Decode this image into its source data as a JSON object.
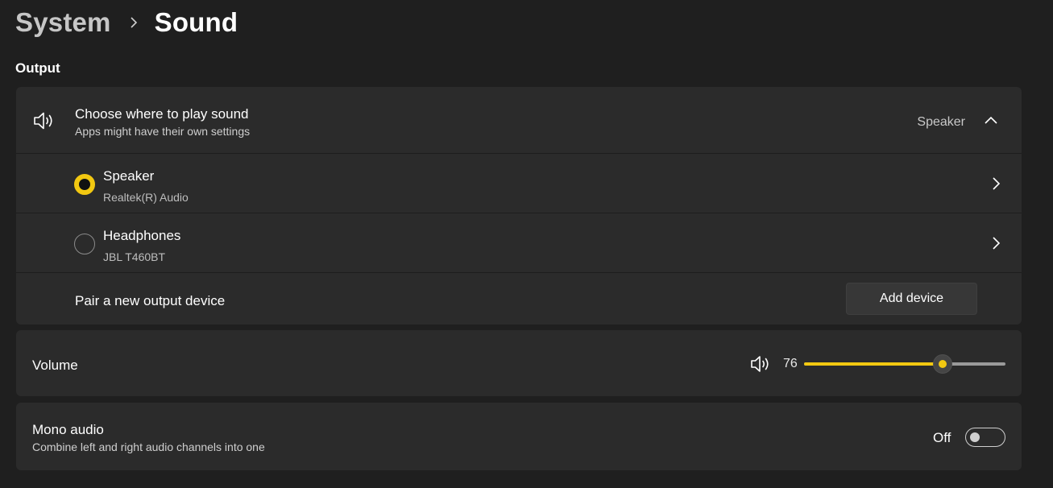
{
  "breadcrumb": {
    "parent": "System",
    "current": "Sound"
  },
  "section": {
    "output_label": "Output"
  },
  "output": {
    "title": "Choose where to play sound",
    "subtitle": "Apps might have their own settings",
    "selected_value": "Speaker",
    "devices": [
      {
        "name": "Speaker",
        "detail": "Realtek(R) Audio",
        "selected": true
      },
      {
        "name": "Headphones",
        "detail": "JBL T460BT",
        "selected": false
      }
    ],
    "pair_label": "Pair a new output device",
    "add_button_label": "Add device"
  },
  "volume": {
    "label": "Volume",
    "value": "76",
    "percent": 76
  },
  "mono": {
    "title": "Mono audio",
    "subtitle": "Combine left and right audio channels into one",
    "state": "Off",
    "on": false
  },
  "colors": {
    "accent": "#f2c811",
    "background": "#1f1f1f",
    "card": "#2b2b2b"
  },
  "icons": {
    "output": "speaker-icon",
    "volume": "speaker-icon",
    "expand": "chevron-up-icon",
    "device_open": "chevron-right-icon",
    "separator": "chevron-right-icon"
  }
}
